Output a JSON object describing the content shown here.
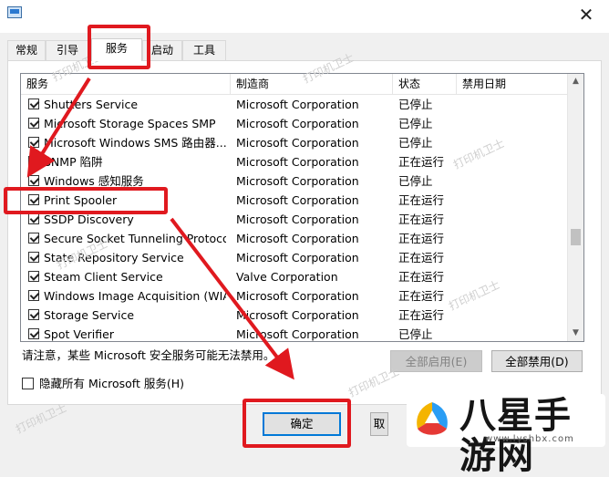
{
  "tabs": [
    {
      "label": "常规"
    },
    {
      "label": "引导"
    },
    {
      "label": "服务"
    },
    {
      "label": "启动"
    },
    {
      "label": "工具"
    }
  ],
  "columns": {
    "service": "服务",
    "vendor": "制造商",
    "status": "状态",
    "disabled_date": "禁用日期"
  },
  "services": [
    {
      "name": "Shutters Service",
      "vendor": "Microsoft Corporation",
      "status": "已停止"
    },
    {
      "name": "Microsoft Storage Spaces SMP",
      "vendor": "Microsoft Corporation",
      "status": "已停止"
    },
    {
      "name": "Microsoft Windows SMS 路由器...",
      "vendor": "Microsoft Corporation",
      "status": "已停止"
    },
    {
      "name": "SNMP 陷阱",
      "vendor": "Microsoft Corporation",
      "status": "正在运行"
    },
    {
      "name": "Windows 感知服务",
      "vendor": "Microsoft Corporation",
      "status": "已停止"
    },
    {
      "name": "Print Spooler",
      "vendor": "Microsoft Corporation",
      "status": "正在运行"
    },
    {
      "name": "SSDP Discovery",
      "vendor": "Microsoft Corporation",
      "status": "正在运行"
    },
    {
      "name": "Secure Socket Tunneling Protoco...",
      "vendor": "Microsoft Corporation",
      "status": "正在运行"
    },
    {
      "name": "State Repository Service",
      "vendor": "Microsoft Corporation",
      "status": "正在运行"
    },
    {
      "name": "Steam Client Service",
      "vendor": "Valve Corporation",
      "status": "正在运行"
    },
    {
      "name": "Windows Image Acquisition (WIA)",
      "vendor": "Microsoft Corporation",
      "status": "正在运行"
    },
    {
      "name": "Storage Service",
      "vendor": "Microsoft Corporation",
      "status": "正在运行"
    },
    {
      "name": "Spot Verifier",
      "vendor": "Microsoft Corporation",
      "status": "已停止"
    }
  ],
  "note": "请注意，某些 Microsoft 安全服务可能无法禁用。",
  "buttons": {
    "enable_all": "全部启用(E)",
    "disable_all": "全部禁用(D)",
    "ok": "确定",
    "cancel_partial": "取"
  },
  "hide_ms_label": "隐藏所有 Microsoft 服务(H)",
  "close_glyph": "✕",
  "watermark": "打印机卫士",
  "brand": {
    "name": "八星手游网",
    "url": "www.lyshbx.com"
  },
  "colors": {
    "highlight": "#e0191f",
    "accent": "#0078d7"
  }
}
